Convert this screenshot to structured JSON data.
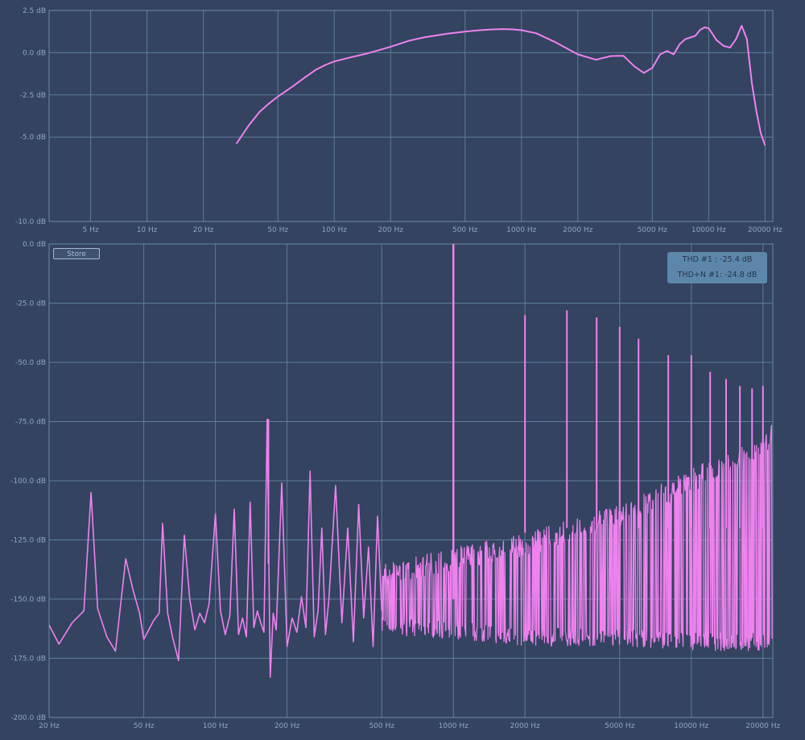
{
  "colors": {
    "background": "#334360",
    "grid": "#5d7d99",
    "tick_text": "#8fa6bf",
    "trace": "#ee82ee"
  },
  "store_button": {
    "label": "Store"
  },
  "thd_box": {
    "thd": "THD #1 : -25.4 dB",
    "thdn": "THD+N #1: -24.8 dB"
  },
  "chart_data": [
    {
      "type": "line",
      "title": "",
      "xscale": "log",
      "xlim": [
        3,
        22000
      ],
      "ylim": [
        -10,
        2.5
      ],
      "grid": true,
      "x_ticks": [
        {
          "value": 5,
          "label": "5 Hz"
        },
        {
          "value": 10,
          "label": "10 Hz"
        },
        {
          "value": 20,
          "label": "20 Hz"
        },
        {
          "value": 50,
          "label": "50 Hz"
        },
        {
          "value": 100,
          "label": "100 Hz"
        },
        {
          "value": 200,
          "label": "200 Hz"
        },
        {
          "value": 500,
          "label": "500 Hz"
        },
        {
          "value": 1000,
          "label": "1000 Hz"
        },
        {
          "value": 2000,
          "label": "2000 Hz"
        },
        {
          "value": 5000,
          "label": "5000 Hz"
        },
        {
          "value": 10000,
          "label": "10000 Hz"
        },
        {
          "value": 20000,
          "label": "20000 Hz"
        }
      ],
      "y_ticks": [
        {
          "value": 2.5,
          "label": "2.5 dB"
        },
        {
          "value": 0,
          "label": "0.0 dB"
        },
        {
          "value": -2.5,
          "label": "-2.5 dB"
        },
        {
          "value": -5,
          "label": "-5.0 dB"
        },
        {
          "value": -10,
          "label": "-10.0 dB"
        }
      ],
      "series": [
        {
          "x": [
            30,
            35,
            40,
            45,
            50,
            60,
            70,
            80,
            90,
            100,
            120,
            150,
            200,
            250,
            300,
            400,
            500,
            600,
            700,
            800,
            900,
            1000,
            1200,
            1500,
            2000,
            2500,
            3000,
            3500,
            4000,
            4500,
            5000,
            5500,
            6000,
            6500,
            7000,
            7500,
            8000,
            8500,
            9000,
            9500,
            10000,
            11000,
            12000,
            13000,
            14000,
            15000,
            16000,
            17000,
            18000,
            19000,
            20000
          ],
          "y": [
            -5.4,
            -4.3,
            -3.5,
            -3.0,
            -2.6,
            -2.0,
            -1.45,
            -1.0,
            -0.72,
            -0.52,
            -0.3,
            -0.05,
            0.35,
            0.7,
            0.9,
            1.12,
            1.25,
            1.33,
            1.38,
            1.4,
            1.38,
            1.33,
            1.15,
            0.65,
            -0.1,
            -0.42,
            -0.2,
            -0.18,
            -0.8,
            -1.2,
            -0.9,
            -0.1,
            0.1,
            -0.1,
            0.5,
            0.8,
            0.9,
            1.0,
            1.35,
            1.5,
            1.45,
            0.75,
            0.4,
            0.3,
            0.8,
            1.6,
            0.8,
            -1.8,
            -3.5,
            -4.8,
            -5.5
          ]
        }
      ]
    },
    {
      "type": "line",
      "title": "",
      "xscale": "log",
      "xlim": [
        20,
        22000
      ],
      "ylim": [
        -200,
        0
      ],
      "grid": true,
      "x_ticks": [
        {
          "value": 20,
          "label": "20 Hz"
        },
        {
          "value": 50,
          "label": "50 Hz"
        },
        {
          "value": 100,
          "label": "100 Hz"
        },
        {
          "value": 200,
          "label": "200 Hz"
        },
        {
          "value": 500,
          "label": "500 Hz"
        },
        {
          "value": 1000,
          "label": "1000 Hz"
        },
        {
          "value": 2000,
          "label": "2000 Hz"
        },
        {
          "value": 5000,
          "label": "5000 Hz"
        },
        {
          "value": 10000,
          "label": "10000 Hz"
        },
        {
          "value": 20000,
          "label": "20000 Hz"
        }
      ],
      "y_ticks": [
        {
          "value": 0,
          "label": "0.0 dB"
        },
        {
          "value": -25,
          "label": "-25.0 dB"
        },
        {
          "value": -50,
          "label": "-50.0 dB"
        },
        {
          "value": -75,
          "label": "-75.0 dB"
        },
        {
          "value": -100,
          "label": "-100.0 dB"
        },
        {
          "value": -125,
          "label": "-125.0 dB"
        },
        {
          "value": -150,
          "label": "-150.0 dB"
        },
        {
          "value": -175,
          "label": "-175.0 dB"
        },
        {
          "value": -200,
          "label": "-200.0 dB"
        }
      ],
      "fundamental": {
        "x": 1000,
        "y": 0
      },
      "harmonics": [
        {
          "x": 167,
          "y": -74
        },
        {
          "x": 2000,
          "y": -30
        },
        {
          "x": 3000,
          "y": -28
        },
        {
          "x": 4000,
          "y": -31
        },
        {
          "x": 5000,
          "y": -35
        },
        {
          "x": 6000,
          "y": -40
        },
        {
          "x": 8000,
          "y": -47
        },
        {
          "x": 10000,
          "y": -47
        },
        {
          "x": 12000,
          "y": -54
        },
        {
          "x": 14000,
          "y": -57
        },
        {
          "x": 16000,
          "y": -60
        },
        {
          "x": 18000,
          "y": -61
        },
        {
          "x": 20000,
          "y": -60
        }
      ],
      "series": [
        {
          "x": [
            20,
            22,
            25,
            28,
            30,
            32,
            35,
            38,
            42,
            45,
            48,
            50,
            55,
            58,
            60,
            63,
            66,
            70,
            74,
            78,
            82,
            86,
            90,
            94,
            100,
            105,
            110,
            115,
            120,
            125,
            130,
            135,
            140,
            145,
            150,
            155,
            160,
            165,
            170,
            175,
            180,
            190,
            200,
            210,
            220,
            230,
            240,
            250,
            260,
            270,
            280,
            290,
            300,
            320,
            340,
            360,
            380,
            400,
            420,
            440,
            460,
            480,
            500
          ],
          "y": [
            -161,
            -169,
            -160,
            -155,
            -105,
            -154,
            -166,
            -172,
            -133,
            -146,
            -156,
            -167,
            -159,
            -156,
            -118,
            -156,
            -166,
            -176,
            -123,
            -150,
            -163,
            -156,
            -160,
            -152,
            -114,
            -155,
            -165,
            -157,
            -112,
            -165,
            -158,
            -166,
            -109,
            -162,
            -155,
            -160,
            -164,
            -74,
            -183,
            -156,
            -163,
            -101,
            -170,
            -158,
            -164,
            -149,
            -162,
            -96,
            -166,
            -155,
            -120,
            -165,
            -150,
            -102,
            -160,
            -120,
            -168,
            -110,
            -158,
            -128,
            -170,
            -115,
            -155
          ]
        }
      ],
      "noise_band": {
        "x": [
          500,
          1000,
          2000,
          5000,
          10000,
          20000,
          22000
        ],
        "upper": [
          -135,
          -128,
          -122,
          -110,
          -95,
          -80,
          -74
        ],
        "lower": [
          -165,
          -167,
          -170,
          -170,
          -172,
          -172,
          -172
        ]
      }
    }
  ]
}
